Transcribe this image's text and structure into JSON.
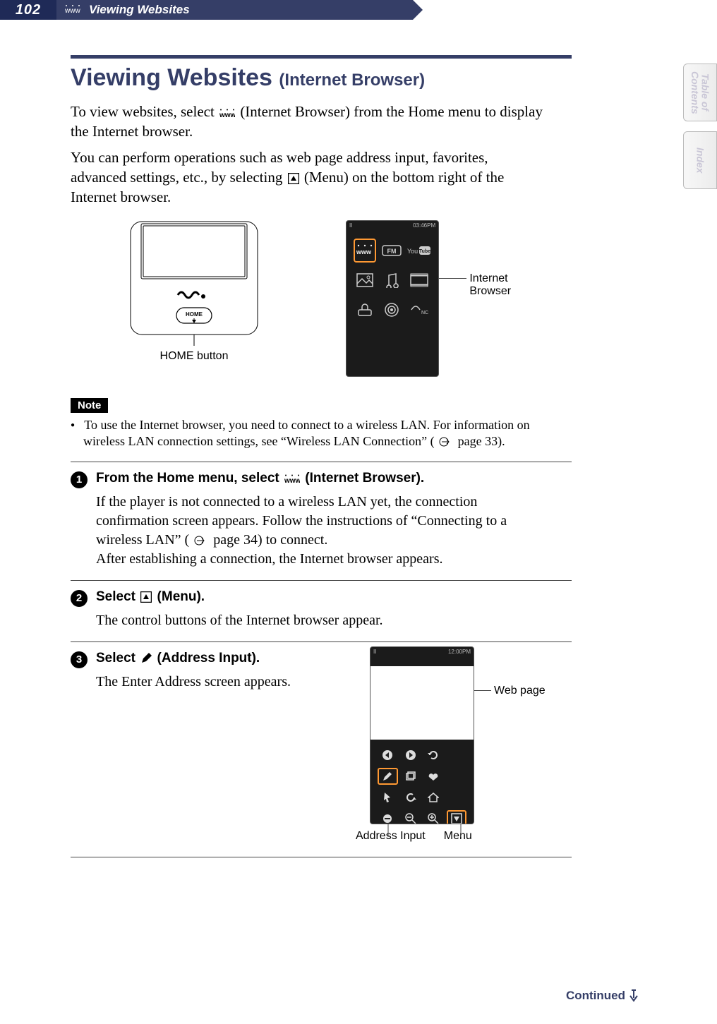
{
  "header": {
    "page_number": "102",
    "section": "Viewing Websites"
  },
  "side_tabs": {
    "toc": "Table of\nContents",
    "index": "Index"
  },
  "title": {
    "main": "Viewing Websites",
    "sub": "(Internet Browser)"
  },
  "intro": {
    "line1a": "To view websites, select ",
    "line1b": " (Internet Browser) from the Home menu to display the Internet browser.",
    "line2": "You can perform operations such as web page address input, favorites, advanced settings, etc., by selecting ",
    "line2b": " (Menu) on the bottom right of the Internet browser."
  },
  "diagram": {
    "home_button": "HOME button",
    "home_label": "HOME",
    "internet_browser": "Internet Browser",
    "clock": "03:46PM",
    "clock2": "12:00PM"
  },
  "note": {
    "label": "Note",
    "item": "To use the Internet browser, you need to connect to a wireless LAN. For information on wireless LAN connection settings, see “Wireless LAN Connection” (",
    "page_ref": " page 33)."
  },
  "steps": {
    "s1": {
      "num": "1",
      "head_a": "From the Home menu, select ",
      "head_b": " (Internet Browser).",
      "body_a": "If the player is not connected to a wireless LAN yet, the connection confirmation screen appears. Follow the instructions of “Connecting to a wireless LAN” (",
      "body_ref": " page 34) to connect.",
      "body_c": "After establishing a connection, the Internet browser appears."
    },
    "s2": {
      "num": "2",
      "head_a": "Select ",
      "head_b": " (Menu).",
      "body": "The control buttons of the Internet browser appear."
    },
    "s3": {
      "num": "3",
      "head_a": "Select ",
      "head_b": " (Address Input).",
      "body": "The Enter Address screen appears."
    }
  },
  "browser_labels": {
    "web_page": "Web page",
    "address_input": "Address Input",
    "menu": "Menu"
  },
  "continued": "Continued"
}
